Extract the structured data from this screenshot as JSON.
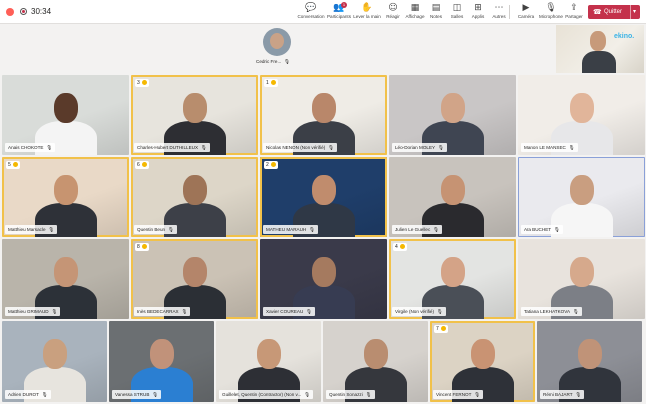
{
  "toolbar": {
    "timer": "30:34",
    "buttons": [
      {
        "icon": "chat-icon",
        "glyph": "💬",
        "label": "Conversation"
      },
      {
        "icon": "participants-icon",
        "glyph": "👥",
        "label": "Participants",
        "badge": "1"
      },
      {
        "icon": "raise-hand-icon",
        "glyph": "✋",
        "label": "Lever la main"
      },
      {
        "icon": "react-icon",
        "glyph": "☺",
        "label": "Réagir"
      },
      {
        "icon": "view-icon",
        "glyph": "▦",
        "label": "Affichage"
      },
      {
        "icon": "notes-icon",
        "glyph": "▤",
        "label": "Notes"
      },
      {
        "icon": "rooms-icon",
        "glyph": "◫",
        "label": "Salles"
      },
      {
        "icon": "apps-icon",
        "glyph": "⊞",
        "label": "Applis"
      },
      {
        "icon": "more-icon",
        "glyph": "⋯",
        "label": "Autres"
      },
      {
        "icon": "camera-icon",
        "glyph": "▶",
        "label": "Caméra"
      },
      {
        "icon": "microphone-icon",
        "glyph": "🎙",
        "label": "Microphone"
      },
      {
        "icon": "share-icon",
        "glyph": "⇪",
        "label": "Partager"
      }
    ],
    "leave_label": "Quitter",
    "leave_color": "#c4314b"
  },
  "featured": {
    "name": "Cedric Fre...",
    "mic": "🎙"
  },
  "self_view": {
    "sign_text": "ekino."
  },
  "colors": {
    "raised_hand_border": "#f1c14a",
    "pinned_border": "#8aa0d8"
  },
  "participants": [
    {
      "name": "Anais CHOKOTE",
      "hand": ""
    },
    {
      "name": "Charles-Hubert DUTHILLEUX",
      "hand": "3"
    },
    {
      "name": "Nicolas NENON (Non vérifié)",
      "hand": "1"
    },
    {
      "name": "Léo-Dorian MOLEY",
      "hand": ""
    },
    {
      "name": "Manon LE MANSEC",
      "hand": ""
    },
    {
      "name": "Matthieu Marsacle",
      "hand": "5"
    },
    {
      "name": "Quentin Beun",
      "hand": "6"
    },
    {
      "name": "MATHEU MARAUH",
      "hand": "2"
    },
    {
      "name": "Julien Le Guellec",
      "hand": ""
    },
    {
      "name": "Aïa BUCHET",
      "hand": ""
    },
    {
      "name": "Matthieu GRIMAUD",
      "hand": ""
    },
    {
      "name": "Inès BEDECARRAX",
      "hand": "8"
    },
    {
      "name": "Xavier COUREAU",
      "hand": ""
    },
    {
      "name": "Virgile (Non vérifié)",
      "hand": "4"
    },
    {
      "name": "Tatiana LEKHATKOVA",
      "hand": ""
    },
    {
      "name": "Adrien DUROT",
      "hand": ""
    },
    {
      "name": "Vanessa STRUB",
      "hand": ""
    },
    {
      "name": "Guillelet, Quentin (Contractor) (Non v...",
      "hand": ""
    },
    {
      "name": "Quentin Sonazzi",
      "hand": ""
    },
    {
      "name": "Vincent FERNOT",
      "hand": "7"
    },
    {
      "name": "Rémi BAJART",
      "hand": ""
    }
  ]
}
